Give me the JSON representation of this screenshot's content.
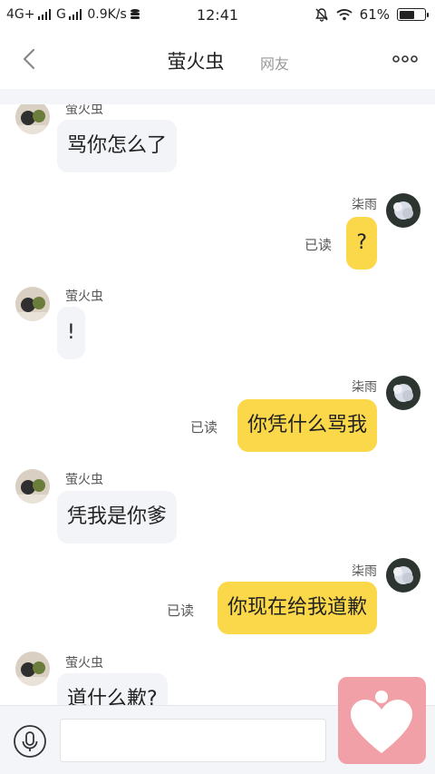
{
  "status_bar": {
    "network_left": "4G+",
    "network_right": "G",
    "speed": "0.9K/s",
    "time": "12:41",
    "battery": "61%",
    "battery_level": 0.61
  },
  "header": {
    "title": "萤火虫",
    "subtitle": "网友"
  },
  "messages": [
    {
      "side": "left",
      "sender": "萤火虫",
      "text": "骂你怎么了"
    },
    {
      "side": "right",
      "sender": "柒雨",
      "text": "?",
      "read": "已读"
    },
    {
      "side": "left",
      "sender": "萤火虫",
      "text": "!"
    },
    {
      "side": "right",
      "sender": "柒雨",
      "text": "你凭什么骂我",
      "read": "已读"
    },
    {
      "side": "left",
      "sender": "萤火虫",
      "text": "凭我是你爹"
    },
    {
      "side": "right",
      "sender": "柒雨",
      "text": "你现在给我道歉",
      "read": "已读"
    },
    {
      "side": "left",
      "sender": "萤火虫",
      "text": "道什么歉?"
    }
  ],
  "input": {
    "placeholder": ""
  },
  "colors": {
    "accent_bubble": "#fbd84a",
    "incoming_bubble": "#f3f4f8",
    "heart_button": "#f0a0a6"
  },
  "icons": [
    "back-icon",
    "more-icon",
    "microphone-icon",
    "heart-icon",
    "mute-bell-icon",
    "wifi-icon",
    "battery-icon"
  ]
}
